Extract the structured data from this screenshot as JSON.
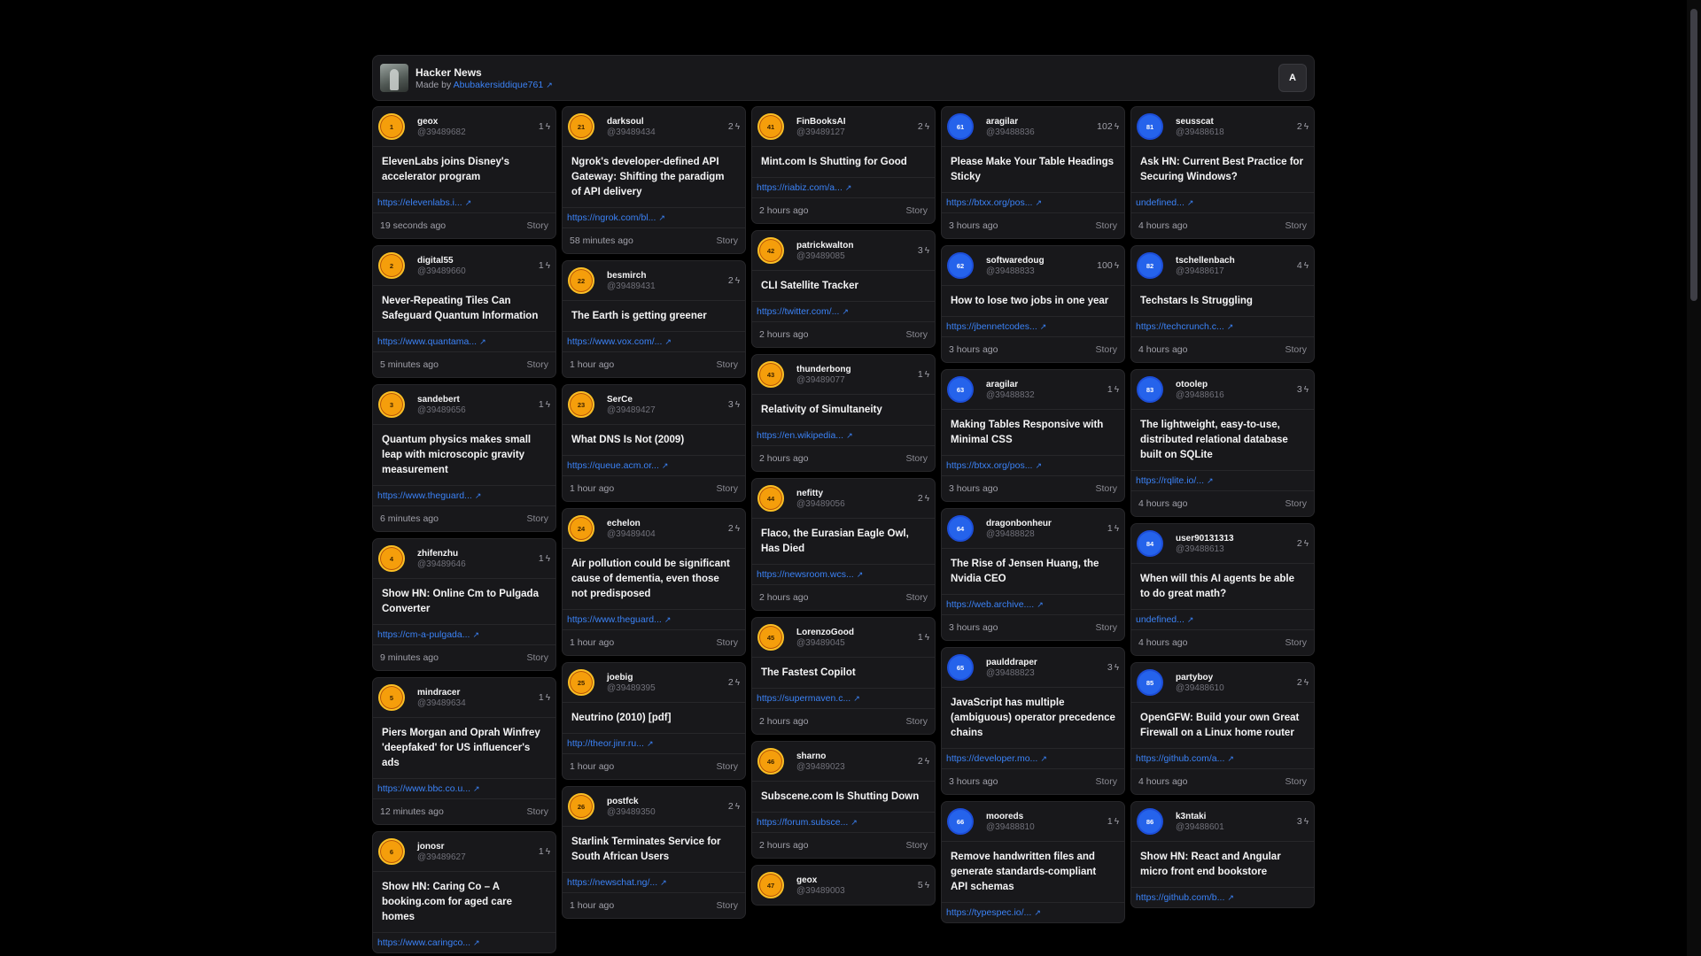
{
  "header": {
    "title": "Hacker News",
    "made_by": "Made by",
    "author": "Abubakersiddique761",
    "avatar_letter": "A"
  },
  "colors": {
    "orange_badge": "#f59e0b",
    "blue_badge": "#2563eb",
    "link": "#3b82f6",
    "card_bg": "#18181b"
  },
  "columns": [
    [
      {
        "rank": "1",
        "user": "geox",
        "id": "@39489682",
        "score": "1",
        "title": "ElevenLabs joins Disney's accelerator program",
        "link": "https://elevenlabs.i...",
        "time": "19 seconds ago",
        "type": "Story",
        "color": "orange"
      },
      {
        "rank": "2",
        "user": "digital55",
        "id": "@39489660",
        "score": "1",
        "title": "Never-Repeating Tiles Can Safeguard Quantum Information",
        "link": "https://www.quantama...",
        "time": "5 minutes ago",
        "type": "Story",
        "color": "orange"
      },
      {
        "rank": "3",
        "user": "sandebert",
        "id": "@39489656",
        "score": "1",
        "title": "Quantum physics makes small leap with microscopic gravity measurement",
        "link": "https://www.theguard...",
        "time": "6 minutes ago",
        "type": "Story",
        "color": "orange"
      },
      {
        "rank": "4",
        "user": "zhifenzhu",
        "id": "@39489646",
        "score": "1",
        "title": "Show HN: Online Cm to Pulgada Converter",
        "link": "https://cm-a-pulgada...",
        "time": "9 minutes ago",
        "type": "Story",
        "color": "orange"
      },
      {
        "rank": "5",
        "user": "mindracer",
        "id": "@39489634",
        "score": "1",
        "title": "Piers Morgan and Oprah Winfrey 'deepfaked' for US influencer's ads",
        "link": "https://www.bbc.co.u...",
        "time": "12 minutes ago",
        "type": "Story",
        "color": "orange"
      },
      {
        "rank": "6",
        "user": "jonosr",
        "id": "@39489627",
        "score": "1",
        "title": "Show HN: Caring Co – A booking.com for aged care homes",
        "link": "https://www.caringco...",
        "time": "",
        "type": "",
        "color": "orange"
      }
    ],
    [
      {
        "rank": "21",
        "user": "darksoul",
        "id": "@39489434",
        "score": "2",
        "title": "Ngrok's developer-defined API Gateway: Shifting the paradigm of API delivery",
        "link": "https://ngrok.com/bl...",
        "time": "58 minutes ago",
        "type": "Story",
        "color": "orange"
      },
      {
        "rank": "22",
        "user": "besmirch",
        "id": "@39489431",
        "score": "2",
        "title": "The Earth is getting greener",
        "link": "https://www.vox.com/...",
        "time": "1 hour ago",
        "type": "Story",
        "color": "orange"
      },
      {
        "rank": "23",
        "user": "SerCe",
        "id": "@39489427",
        "score": "3",
        "title": "What DNS Is Not (2009)",
        "link": "https://queue.acm.or...",
        "time": "1 hour ago",
        "type": "Story",
        "color": "orange"
      },
      {
        "rank": "24",
        "user": "echelon",
        "id": "@39489404",
        "score": "2",
        "title": "Air pollution could be significant cause of dementia, even those not predisposed",
        "link": "https://www.theguard...",
        "time": "1 hour ago",
        "type": "Story",
        "color": "orange"
      },
      {
        "rank": "25",
        "user": "joebig",
        "id": "@39489395",
        "score": "2",
        "title": "Neutrino (2010) [pdf]",
        "link": "http://theor.jinr.ru...",
        "time": "1 hour ago",
        "type": "Story",
        "color": "orange"
      },
      {
        "rank": "26",
        "user": "postfck",
        "id": "@39489350",
        "score": "2",
        "title": "Starlink Terminates Service for South African Users",
        "link": "https://newschat.ng/...",
        "time": "1 hour ago",
        "type": "Story",
        "color": "orange"
      }
    ],
    [
      {
        "rank": "41",
        "user": "FinBooksAI",
        "id": "@39489127",
        "score": "2",
        "title": "Mint.com Is Shutting for Good",
        "link": "https://riabiz.com/a...",
        "time": "2 hours ago",
        "type": "Story",
        "color": "orange"
      },
      {
        "rank": "42",
        "user": "patrickwalton",
        "id": "@39489085",
        "score": "3",
        "title": "CLI Satellite Tracker",
        "link": "https://twitter.com/...",
        "time": "2 hours ago",
        "type": "Story",
        "color": "orange"
      },
      {
        "rank": "43",
        "user": "thunderbong",
        "id": "@39489077",
        "score": "1",
        "title": "Relativity of Simultaneity",
        "link": "https://en.wikipedia...",
        "time": "2 hours ago",
        "type": "Story",
        "color": "orange"
      },
      {
        "rank": "44",
        "user": "nefitty",
        "id": "@39489056",
        "score": "2",
        "title": "Flaco, the Eurasian Eagle Owl, Has Died",
        "link": "https://newsroom.wcs...",
        "time": "2 hours ago",
        "type": "Story",
        "color": "orange"
      },
      {
        "rank": "45",
        "user": "LorenzoGood",
        "id": "@39489045",
        "score": "1",
        "title": "The Fastest Copilot",
        "link": "https://supermaven.c...",
        "time": "2 hours ago",
        "type": "Story",
        "color": "orange"
      },
      {
        "rank": "46",
        "user": "sharno",
        "id": "@39489023",
        "score": "2",
        "title": "Subscene.com Is Shutting Down",
        "link": "https://forum.subsce...",
        "time": "2 hours ago",
        "type": "Story",
        "color": "orange"
      },
      {
        "rank": "47",
        "user": "geox",
        "id": "@39489003",
        "score": "5",
        "title": "",
        "link": "",
        "time": "",
        "type": "",
        "color": "orange"
      }
    ],
    [
      {
        "rank": "61",
        "user": "aragilar",
        "id": "@39488836",
        "score": "102",
        "title": "Please Make Your Table Headings Sticky",
        "link": "https://btxx.org/pos...",
        "time": "3 hours ago",
        "type": "Story",
        "color": "blue"
      },
      {
        "rank": "62",
        "user": "softwaredoug",
        "id": "@39488833",
        "score": "100",
        "title": "How to lose two jobs in one year",
        "link": "https://jbennetcodes...",
        "time": "3 hours ago",
        "type": "Story",
        "color": "blue"
      },
      {
        "rank": "63",
        "user": "aragilar",
        "id": "@39488832",
        "score": "1",
        "title": "Making Tables Responsive with Minimal CSS",
        "link": "https://btxx.org/pos...",
        "time": "3 hours ago",
        "type": "Story",
        "color": "blue"
      },
      {
        "rank": "64",
        "user": "dragonbonheur",
        "id": "@39488828",
        "score": "1",
        "title": "The Rise of Jensen Huang, the Nvidia CEO",
        "link": "https://web.archive....",
        "time": "3 hours ago",
        "type": "Story",
        "color": "blue"
      },
      {
        "rank": "65",
        "user": "paulddraper",
        "id": "@39488823",
        "score": "3",
        "title": "JavaScript has multiple (ambiguous) operator precedence chains",
        "link": "https://developer.mo...",
        "time": "3 hours ago",
        "type": "Story",
        "color": "blue"
      },
      {
        "rank": "66",
        "user": "mooreds",
        "id": "@39488810",
        "score": "1",
        "title": "Remove handwritten files and generate standards-compliant API schemas",
        "link": "https://typespec.io/...",
        "time": "",
        "type": "",
        "color": "blue"
      }
    ],
    [
      {
        "rank": "81",
        "user": "seusscat",
        "id": "@39488618",
        "score": "2",
        "title": "Ask HN: Current Best Practice for Securing Windows?",
        "link": "undefined...",
        "time": "4 hours ago",
        "type": "Story",
        "color": "blue"
      },
      {
        "rank": "82",
        "user": "tschellenbach",
        "id": "@39488617",
        "score": "4",
        "title": "Techstars Is Struggling",
        "link": "https://techcrunch.c...",
        "time": "4 hours ago",
        "type": "Story",
        "color": "blue"
      },
      {
        "rank": "83",
        "user": "otoolep",
        "id": "@39488616",
        "score": "3",
        "title": "The lightweight, easy-to-use, distributed relational database built on SQLite",
        "link": "https://rqlite.io/...",
        "time": "4 hours ago",
        "type": "Story",
        "color": "blue"
      },
      {
        "rank": "84",
        "user": "user90131313",
        "id": "@39488613",
        "score": "2",
        "title": "When will this AI agents be able to do great math?",
        "link": "undefined...",
        "time": "4 hours ago",
        "type": "Story",
        "color": "blue"
      },
      {
        "rank": "85",
        "user": "partyboy",
        "id": "@39488610",
        "score": "2",
        "title": "OpenGFW: Build your own Great Firewall on a Linux home router",
        "link": "https://github.com/a...",
        "time": "4 hours ago",
        "type": "Story",
        "color": "blue"
      },
      {
        "rank": "86",
        "user": "k3ntaki",
        "id": "@39488601",
        "score": "3",
        "title": "Show HN: React and Angular micro front end bookstore",
        "link": "https://github.com/b...",
        "time": "",
        "type": "",
        "color": "blue"
      }
    ]
  ]
}
